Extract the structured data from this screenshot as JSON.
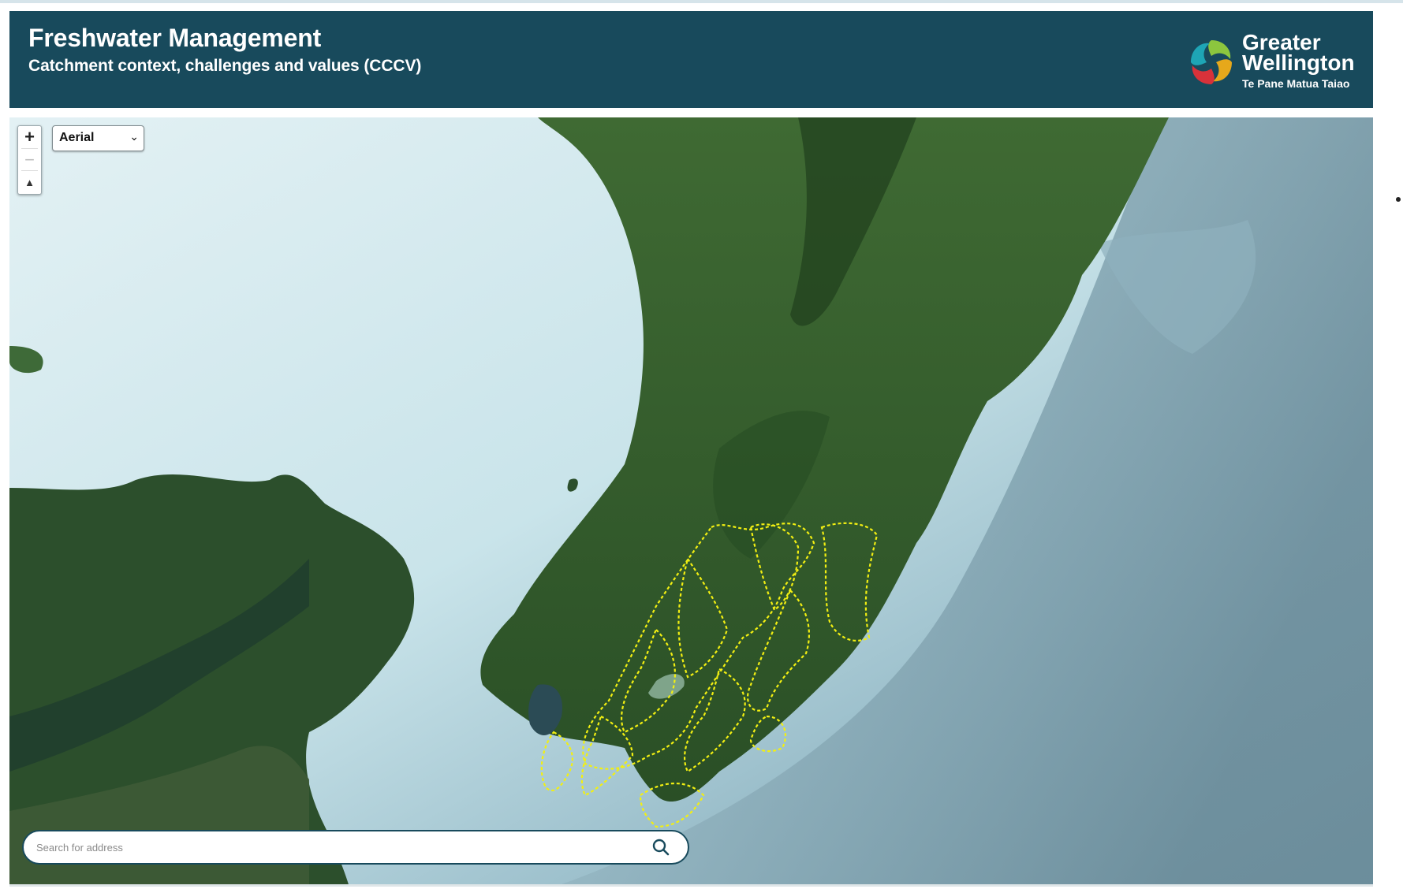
{
  "header": {
    "title": "Freshwater Management",
    "subtitle": "Catchment context, challenges and values (CCCV)"
  },
  "logo": {
    "line1": "Greater",
    "line2": "Wellington",
    "line3": "Te Pane Matua Taiao"
  },
  "map_controls": {
    "zoom_in": "+",
    "zoom_out": "−",
    "compass": "▲",
    "basemap_selected": "Aerial"
  },
  "search": {
    "placeholder": "Search for address"
  },
  "colors": {
    "header_bg": "#184a5c",
    "catchment_outline": "#f2ef12",
    "land": "#2f5a2a",
    "shallow_sea": "#d7ecef",
    "deep_sea": "#6f93a2"
  },
  "icons": {
    "zoom_in": "plus-icon",
    "zoom_out": "minus-icon",
    "compass": "compass-icon",
    "search": "search-icon",
    "basemap_dropdown": "chevron-down-icon"
  }
}
